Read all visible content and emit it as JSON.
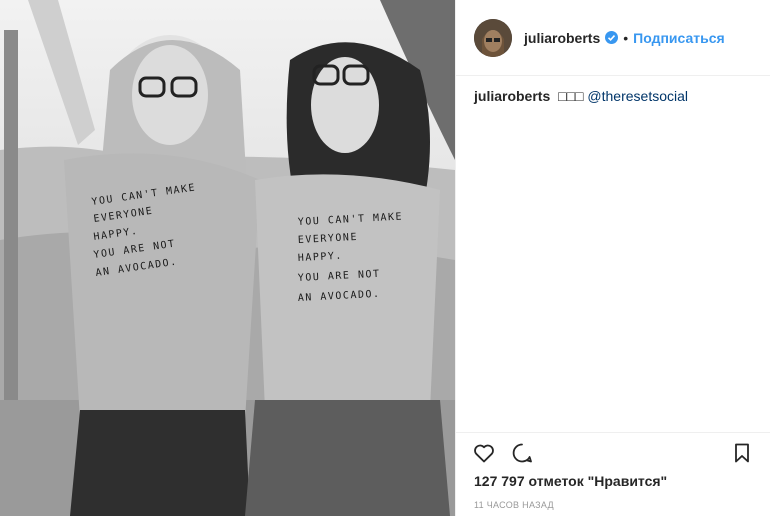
{
  "post": {
    "username": "juliaroberts",
    "separator": "•",
    "follow_label": "Подписаться",
    "caption": {
      "username": "juliaroberts",
      "emojis": "□□□",
      "mention": "@theresetsocial"
    },
    "likes_text": "127 797 отметок \"Нравится\"",
    "time_text": "11 часов назад",
    "shirt_text": [
      "YOU CAN'T MAKE",
      "EVERYONE",
      "HAPPY.",
      "YOU ARE NOT",
      "AN AVOCADO."
    ]
  },
  "icons": {
    "verified": "verified-badge-icon",
    "like": "heart-icon",
    "comment": "comment-icon",
    "save": "bookmark-icon"
  },
  "colors": {
    "link": "#3897f0",
    "mention": "#003569",
    "text": "#262626",
    "muted": "#999999"
  }
}
